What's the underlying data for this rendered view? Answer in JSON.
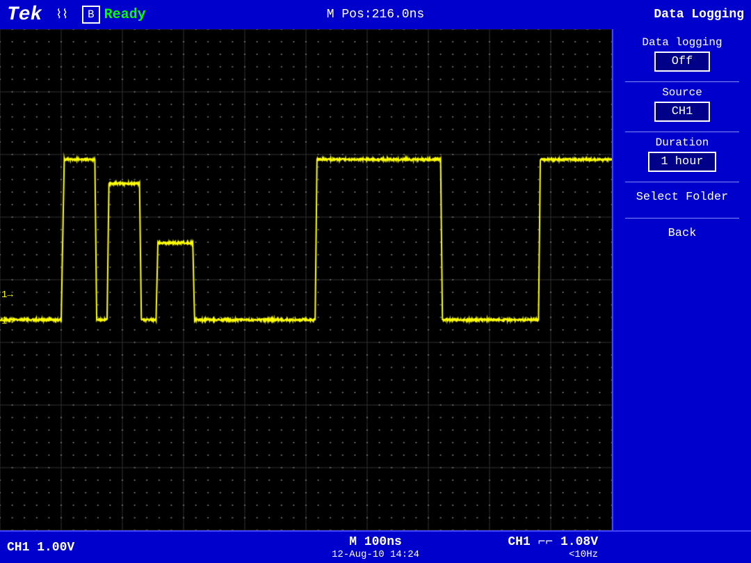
{
  "header": {
    "logo": "Tek",
    "trig_symbol": "⌇",
    "trigger_indicator": "B",
    "status": "Ready",
    "position_label": "M Pos:",
    "position_value": "216.0ns",
    "title": "Data Logging"
  },
  "right_panel": {
    "data_logging_label": "Data logging",
    "data_logging_value": "Off",
    "source_label": "Source",
    "source_value": "CH1",
    "duration_label": "Duration",
    "duration_value": "1 hour",
    "select_folder_label": "Select Folder",
    "back_label": "Back"
  },
  "bottom_bar": {
    "ch1_scale": "CH1  1.00V",
    "timebase": "M 100ns",
    "datetime": "12-Aug-10  14:24",
    "ch1_trigger": "CH1 ⌐⌐ 1.08V",
    "freq": "<10Hz"
  },
  "grid": {
    "cols": 10,
    "rows": 8,
    "color": "#555555",
    "dot_color": "#888888"
  },
  "waveform": {
    "color": "#ffff00",
    "baseline_y_fraction": 0.58
  }
}
